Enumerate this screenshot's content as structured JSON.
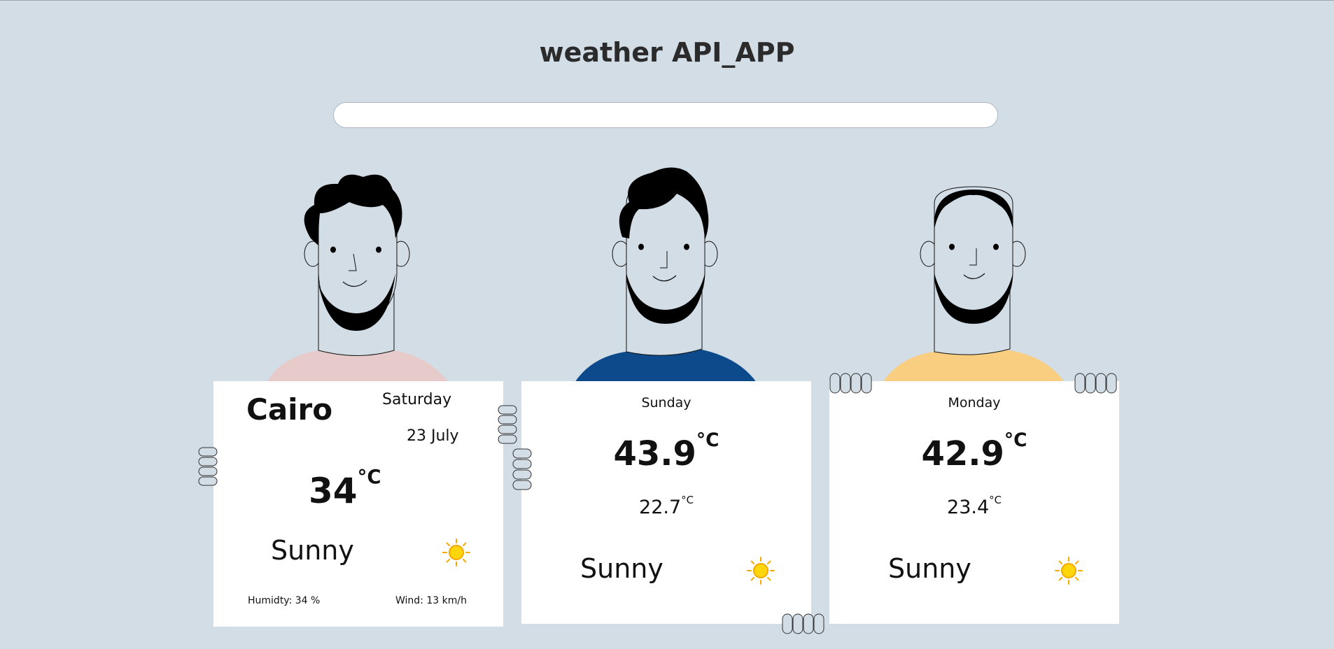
{
  "app": {
    "title": "weather API_APP"
  },
  "search": {
    "placeholder": "",
    "value": ""
  },
  "colors": {
    "background": "#d2dde6",
    "shirt_1": "#e6cbca",
    "shirt_2": "#0c4a8c",
    "shirt_3": "#f9ce80",
    "sun": "#ffd60a",
    "sun_rays": "#f6a800"
  },
  "today": {
    "city": "Cairo",
    "day": "Saturday",
    "date": "23 July",
    "temp": "34",
    "unit": "°C",
    "condition": "Sunny",
    "icon": "sun-icon",
    "humidity": "Humidty: 34 %",
    "wind": "Wind: 13 km/h"
  },
  "forecast": [
    {
      "day": "Sunday",
      "max": "43.9",
      "min": "22.7",
      "unit": "°C",
      "condition": "Sunny",
      "icon": "sun-icon"
    },
    {
      "day": "Monday",
      "max": "42.9",
      "min": "23.4",
      "unit": "°C",
      "condition": "Sunny",
      "icon": "sun-icon"
    }
  ]
}
